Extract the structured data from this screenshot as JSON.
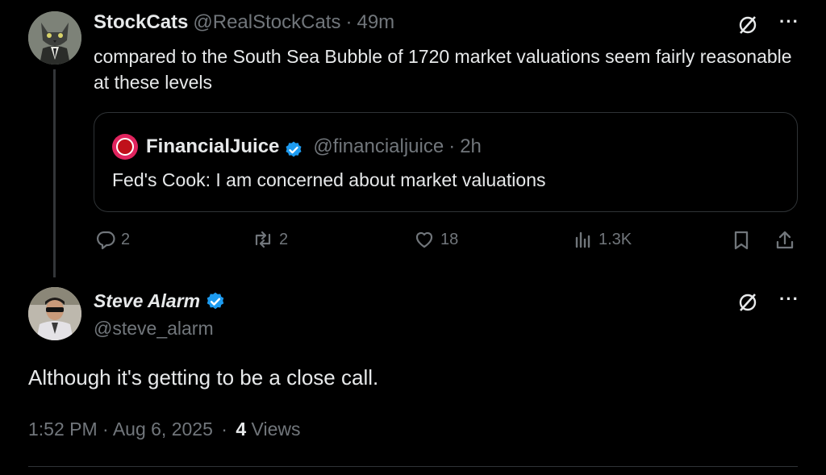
{
  "parent_tweet": {
    "author_name": "StockCats",
    "handle": "@RealStockCats",
    "time": "49m",
    "text": "compared to the South Sea Bubble of 1720 market valuations seem fairly reasonable at these levels",
    "quote": {
      "author_name": "FinancialJuice",
      "handle": "@financialjuice",
      "time": "2h",
      "text": "Fed's Cook: I am concerned about market valuations"
    },
    "actions": {
      "replies": "2",
      "reposts": "2",
      "likes": "18",
      "views": "1.3K"
    }
  },
  "main_tweet": {
    "author_name": "Steve Alarm",
    "handle": "@steve_alarm",
    "text": "Although it's getting to be a close call.",
    "timestamp": "1:52 PM · Aug 6, 2025",
    "views_count": "4",
    "views_label": "Views"
  },
  "separator": "·",
  "more_glyph": "···",
  "colors": {
    "background": "#000000",
    "text": "#e7e9ea",
    "muted": "#71767b",
    "verified": "#1d9bf0",
    "border": "#2f3336"
  },
  "icons": [
    "grok-icon",
    "more-icon",
    "verified-badge-icon",
    "reply-icon",
    "repost-icon",
    "like-icon",
    "views-icon",
    "bookmark-icon",
    "share-icon"
  ]
}
